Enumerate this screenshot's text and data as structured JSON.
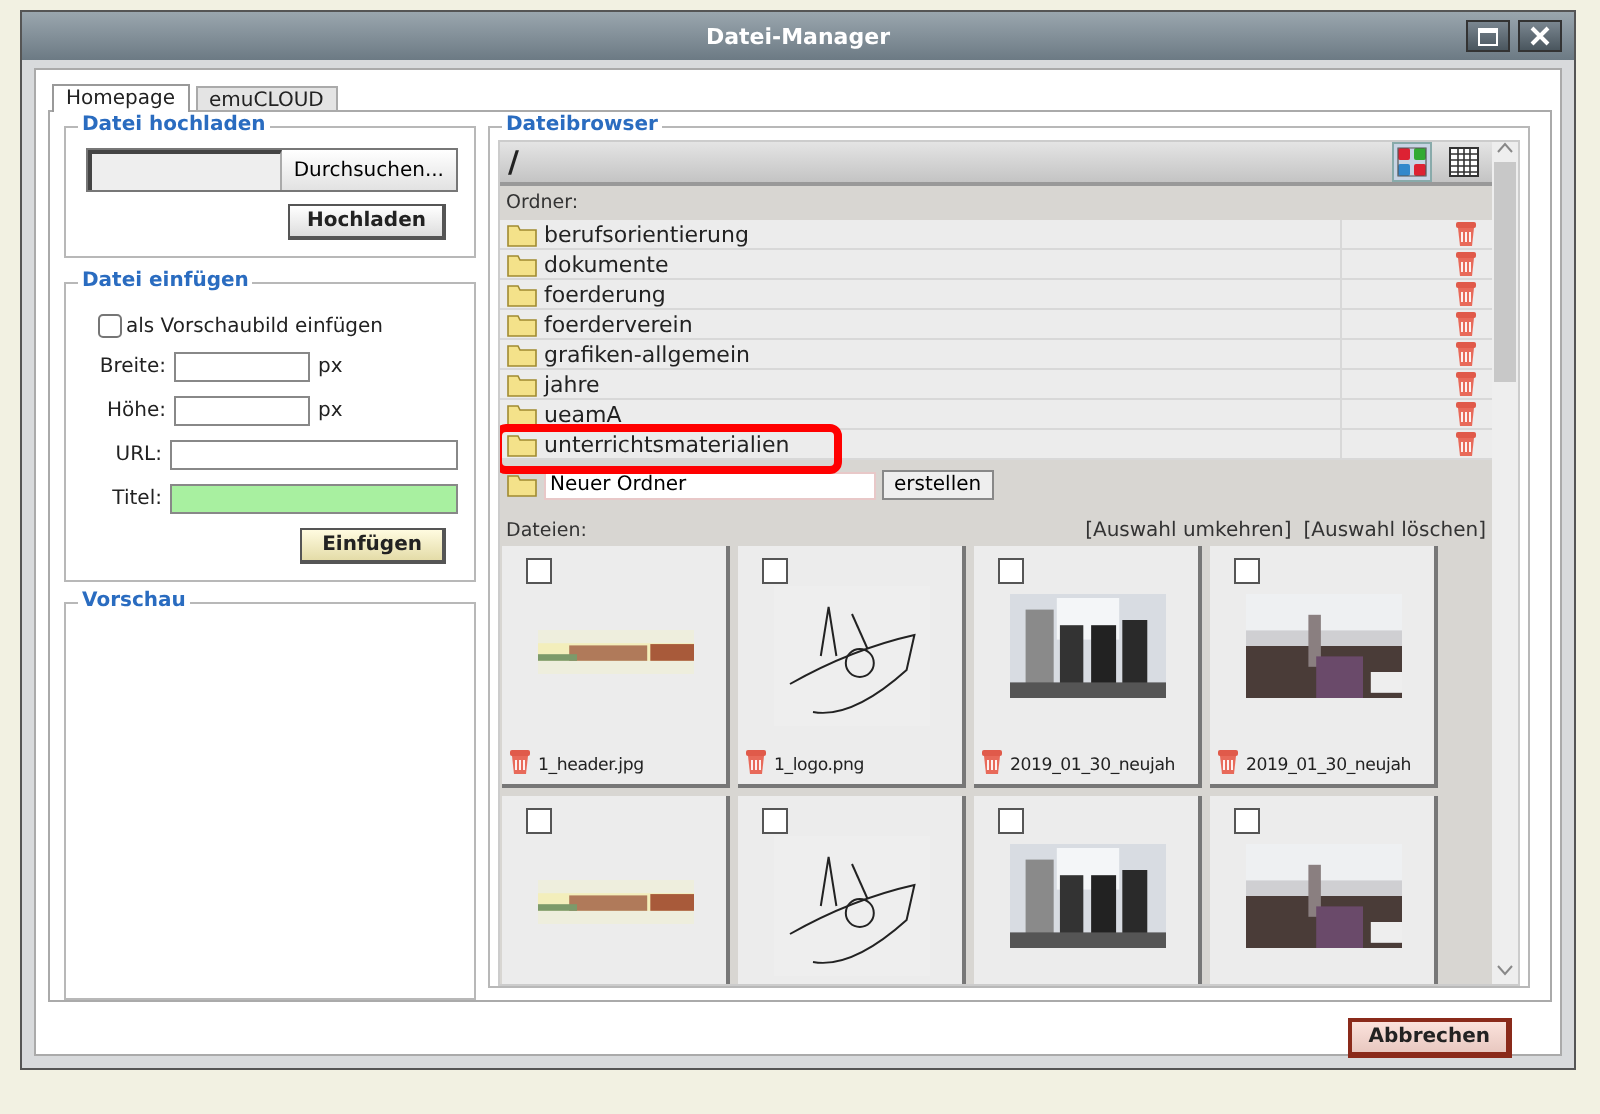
{
  "window": {
    "title": "Datei-Manager",
    "buttons": [
      {
        "kind": "maximize"
      },
      {
        "kind": "close"
      }
    ]
  },
  "tabs": [
    {
      "label": "Homepage",
      "selected": true
    },
    {
      "label": "emuCLOUD",
      "selected": false
    }
  ],
  "upload": {
    "title": "Datei hochladen",
    "browse_button": "Durchsuchen...",
    "upload_button": "Hochladen"
  },
  "insert": {
    "title": "Datei einfügen",
    "thumbnail_option": {
      "label": "als Vorschaubild einfügen",
      "checked": false
    },
    "fields": [
      {
        "label": "Breite:",
        "unit": "px",
        "highlighted": false
      },
      {
        "label": "Höhe:",
        "unit": "px",
        "highlighted": false
      },
      {
        "label": "URL:",
        "highlighted": false
      },
      {
        "label": "Titel:",
        "highlighted": true
      }
    ],
    "insert_button": "Einfügen"
  },
  "preview": {
    "title": "Vorschau"
  },
  "browser": {
    "title": "Dateibrowser",
    "path": "/",
    "views": [
      {
        "kind": "icons",
        "selected": true
      },
      {
        "kind": "list",
        "selected": false
      }
    ],
    "folders_label": "Ordner:",
    "folders": [
      {
        "name": "berufsorientierung",
        "highlighted": false
      },
      {
        "name": "dokumente",
        "highlighted": false
      },
      {
        "name": "foerderung",
        "highlighted": false
      },
      {
        "name": "foerderverein",
        "highlighted": false
      },
      {
        "name": "grafiken-allgemein",
        "highlighted": false
      },
      {
        "name": "jahre",
        "highlighted": false
      },
      {
        "name": "ueamA",
        "highlighted": false
      },
      {
        "name": "unterrichtsmaterialien",
        "highlighted": true
      }
    ],
    "new_folder": {
      "value": "Neuer Ordner"
    },
    "create_button": "erstellen",
    "files_label": "Dateien:",
    "actions": [
      "[Auswahl umkehren]",
      "[Auswahl löschen]"
    ],
    "files": [
      {
        "name": "1_header.jpg",
        "checked": false
      },
      {
        "name": "1_logo.png",
        "checked": false
      },
      {
        "name": "2019_01_30_neujah",
        "checked": false
      },
      {
        "name": "2019_01_30_neujah",
        "checked": false
      },
      {
        "checked": false
      },
      {
        "checked": false
      },
      {
        "checked": false
      },
      {
        "checked": false
      }
    ]
  },
  "cancel_button": "Abbrechen"
}
